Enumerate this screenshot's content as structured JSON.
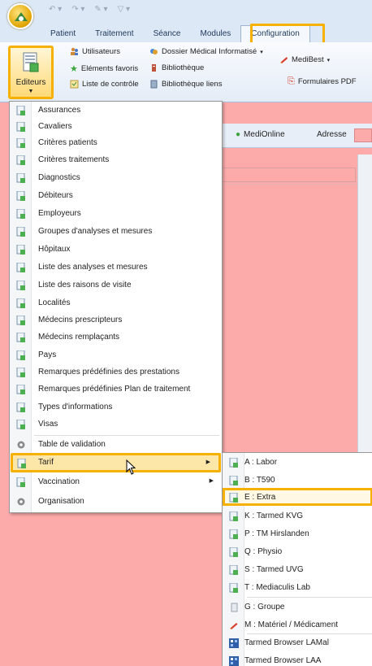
{
  "tabs": [
    {
      "label": "Patient"
    },
    {
      "label": "Traitement"
    },
    {
      "label": "Séance"
    },
    {
      "label": "Modules"
    },
    {
      "label": "Configuration",
      "active": true
    }
  ],
  "ribbon": {
    "editeurs_label": "Editeurs",
    "utilisateurs": "Utilisateurs",
    "elements_favoris": "Eléments favoris",
    "liste_controle": "Liste de contrôle",
    "dossier_medical": "Dossier Médical Informatisé",
    "bibliotheque": "Bibliothèque",
    "bibliotheque_liens": "Bibliothèque liens",
    "medibest": "MediBest",
    "formulaires_pdf": "Formulaires PDF"
  },
  "workspace": {
    "medionline": "MediOnline",
    "adresse": "Adresse"
  },
  "menu": {
    "items": [
      {
        "label": "Assurances"
      },
      {
        "label": "Cavaliers"
      },
      {
        "label": "Critères patients"
      },
      {
        "label": "Critères traitements"
      },
      {
        "label": "Diagnostics"
      },
      {
        "label": "Débiteurs"
      },
      {
        "label": "Employeurs"
      },
      {
        "label": "Groupes d'analyses et mesures"
      },
      {
        "label": "Hôpitaux"
      },
      {
        "label": "Liste des analyses et mesures"
      },
      {
        "label": "Liste des raisons de visite"
      },
      {
        "label": "Localités"
      },
      {
        "label": "Médecins prescripteurs"
      },
      {
        "label": "Médecins remplaçants"
      },
      {
        "label": "Pays"
      },
      {
        "label": "Remarques prédéfinies des prestations"
      },
      {
        "label": "Remarques prédéfinies Plan de traitement"
      },
      {
        "label": "Types d'informations"
      },
      {
        "label": "Visas"
      }
    ],
    "validation": "Table de validation",
    "tarif": "Tarif",
    "vaccination": "Vaccination",
    "organisation": "Organisation"
  },
  "submenu": {
    "items": [
      {
        "label": "A : Labor"
      },
      {
        "label": "B : T590"
      },
      {
        "label": "E : Extra"
      },
      {
        "label": "K : Tarmed KVG"
      },
      {
        "label": "P : TM Hirslanden"
      },
      {
        "label": "Q : Physio"
      },
      {
        "label": "S : Tarmed UVG"
      },
      {
        "label": "T : Mediaculis Lab"
      }
    ],
    "groupe": "G : Groupe",
    "materiel": "M : Matériel / Médicament",
    "browser_lamal": "Tarmed Browser LAMal",
    "browser_laa": "Tarmed Browser LAA"
  },
  "colors": {
    "highlight": "#f5b000",
    "workspace": "#fcaaaa",
    "ribbon": "#e4ecf7"
  }
}
